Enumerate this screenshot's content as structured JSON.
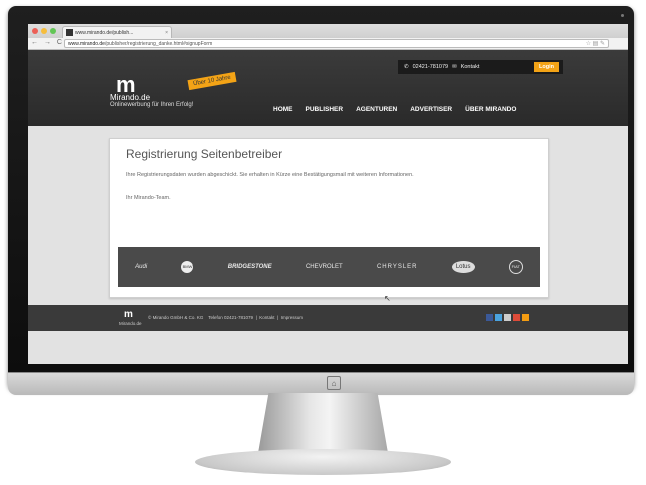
{
  "browser": {
    "tab_title": "www.mirando.de/publish...",
    "tab_close": "×",
    "nav": "← → C",
    "url_host": "www.mirando.de",
    "url_path": "/publisher/registrierung_danke.html#signupForm",
    "tools": "☆ ▤ ✎"
  },
  "header": {
    "logo_mark": "m",
    "brand_name": "Mirando.de",
    "tagline": "Onlinewerbung für Ihren Erfolg!",
    "ribbon": "Über 10 Jahre",
    "phone": "02421-781079",
    "contact": "Kontakt",
    "login": "Login",
    "menu": [
      "HOME",
      "PUBLISHER",
      "AGENTUREN",
      "ADVERTISER",
      "ÜBER MIRANDO"
    ]
  },
  "content": {
    "title": "Registrierung Seitenbetreiber",
    "message": "Ihre Registrierungsdaten wurden abgeschickt. Sie erhalten in Kürze eine Bestätigungsmail mit weiteren Informationen.",
    "signoff": "Ihr Mirando-Team."
  },
  "brands": [
    "Audi",
    "BMW",
    "BRIDGESTONE",
    "CHEVROLET",
    "CHRYSLER",
    "Lotus",
    "FIAT"
  ],
  "footer": {
    "logo_mark": "m",
    "logo_small": "Mirando.de",
    "company": "© Mirando GmbH & Co. KG",
    "phone": "Telefon 02421-781079",
    "sep1": "|",
    "contact": "Kontakt",
    "sep2": "|",
    "imprint": "Impressum",
    "social_colors": [
      "#3b5998",
      "#4aa3df",
      "#cccccc",
      "#dd4b39",
      "#f39c12"
    ]
  },
  "colors": {
    "accent": "#f3a316",
    "dark": "#2e2e2e"
  },
  "cursor": "↖"
}
